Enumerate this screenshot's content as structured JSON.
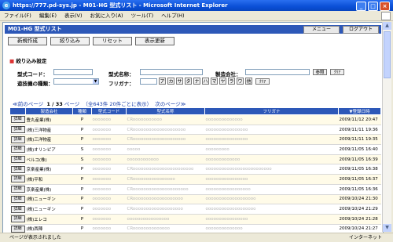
{
  "window": {
    "title": "https://777.pd-sys.jp - M01-HG 型式リスト - Microsoft Internet Explorer",
    "min": "_",
    "max": "□",
    "close": "×"
  },
  "menu": [
    "ファイル(F)",
    "編集(E)",
    "表示(V)",
    "お気に入り(A)",
    "ツール(T)",
    "ヘルプ(H)"
  ],
  "page": {
    "header_title": "M01-HG 型式リスト",
    "menu_button": "メニュー",
    "logout_button": "ログアウト"
  },
  "toolbar": {
    "new": "新規作成",
    "filter": "絞り込み",
    "reset": "リセット",
    "refresh": "表示更新"
  },
  "filter": {
    "section_title": "絞り込み設定",
    "type_code_label": "型式コード：",
    "type_name_label": "型式名称：",
    "maker_label": "製造会社：",
    "kind_label": "遊技機の種類：",
    "furigana_label": "フリガナ：",
    "ref_button": "参照",
    "clear_button": "ｸﾘｱ",
    "clear_button2": "ｸﾘｱ",
    "kana": [
      "ア",
      "カ",
      "サ",
      "タ",
      "ナ",
      "ハ",
      "マ",
      "ヤ",
      "ラ",
      "ワ",
      "他"
    ]
  },
  "pager": {
    "prev": "≪前のページ",
    "current": "1 / 33",
    "page_word": "ページ",
    "info": "（全643件 20件ごとに表示）",
    "next": "次のページ≫"
  },
  "table": {
    "columns": [
      "製造会社",
      "種類",
      "型式コード",
      "型式名称",
      "フリガナ",
      "▼登録日時"
    ],
    "detail_label": "詳細",
    "rows": [
      {
        "maker": "豊丸産業(株)",
        "kind": "P",
        "code": "ooooooo",
        "name": "CRooooooooooo",
        "furi": "oooooooooooooo",
        "date": "2009/11/12 20:47"
      },
      {
        "maker": "(株)三洋物産",
        "kind": "P",
        "code": "ooooooo",
        "name": "CRoooooooooooooooooooo",
        "furi": "oooooooooooooooo",
        "date": "2009/11/11 19:36"
      },
      {
        "maker": "(株)三洋物産",
        "kind": "P",
        "code": "ooooooo",
        "name": "CRoooooooooooooooooooo",
        "furi": "oooooooooooooooo",
        "date": "2009/11/11 19:35"
      },
      {
        "maker": "(株)オリンピア",
        "kind": "S",
        "code": "ooooooo",
        "name": "ooooo",
        "furi": "ooooooooo",
        "date": "2009/11/05 16:40"
      },
      {
        "maker": "ベルコ(株)",
        "kind": "S",
        "code": "ooooooo",
        "name": "oooooooooooo",
        "furi": "ooooooooooooo",
        "date": "2009/11/05 16:39"
      },
      {
        "maker": "京楽産業(株)",
        "kind": "P",
        "code": "ooooooo",
        "name": "CRooooooooooooooooooooooo",
        "furi": "ooooooooooooooooooooooooo",
        "date": "2009/11/05 16:38"
      },
      {
        "maker": "(株)平和",
        "kind": "P",
        "code": "ooooooo",
        "name": "CRoooooooooooooooo",
        "furi": "oooooooooooooooo",
        "date": "2009/11/05 16:37"
      },
      {
        "maker": "京楽産業(株)",
        "kind": "P",
        "code": "ooooooo",
        "name": "CRooooooooooooooooooooo",
        "furi": "ooooooooooooooooo",
        "date": "2009/11/05 16:36"
      },
      {
        "maker": "(株)ニューギン",
        "kind": "P",
        "code": "ooooooo",
        "name": "CRooooooooooooooooooo",
        "furi": "ooooooooooooooooooo",
        "date": "2009/10/24 21:30"
      },
      {
        "maker": "(株)ニューギン",
        "kind": "P",
        "code": "ooooooo",
        "name": "CRooooooooooooooooooo",
        "furi": "ooooooooooooooooooo",
        "date": "2009/10/24 21:29"
      },
      {
        "maker": "(株)エレコ",
        "kind": "P",
        "code": "ooooooo",
        "name": "oooooooooooooooo",
        "furi": "oooooooooooooooo",
        "date": "2009/10/24 21:28"
      },
      {
        "maker": "(株)西陣",
        "kind": "P",
        "code": "ooooooo",
        "name": "CRoooooooooooooo",
        "furi": "oooooooooooooo",
        "date": "2009/10/24 21:27"
      }
    ]
  },
  "status": {
    "left": "ページが表示されました",
    "zone": "インターネット"
  }
}
